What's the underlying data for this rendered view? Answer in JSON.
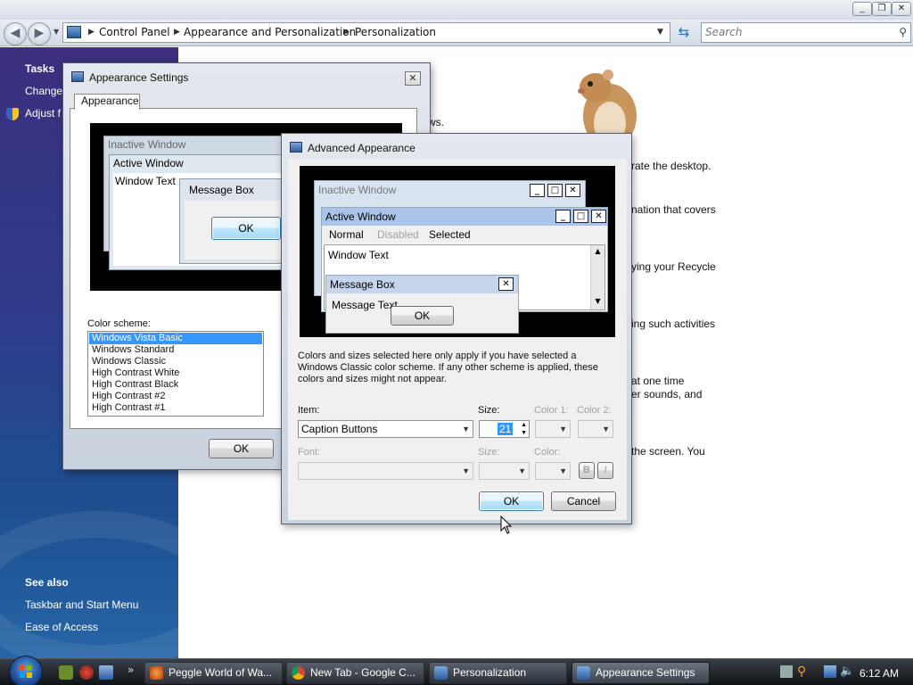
{
  "explorer": {
    "address_segments": [
      "Control Panel",
      "Appearance and Personalization",
      "Personalization"
    ],
    "search_placeholder": "Search"
  },
  "taskpane": {
    "tasks_heading": "Tasks",
    "task_items": [
      "Change",
      "Adjust f"
    ],
    "see_also_heading": "See also",
    "see_also_items": [
      "Taskbar and Start Menu",
      "Ease of Access"
    ]
  },
  "content": {
    "lines": [
      "ws.",
      "rate the desktop.",
      "nation that covers",
      "ying your Recycle",
      "ing such activities",
      "at one time",
      "er sounds, and",
      "the screen. You"
    ]
  },
  "appearance_dialog": {
    "title": "Appearance Settings",
    "tab_label": "Appearance",
    "preview": {
      "inactive_title": "Inactive Window",
      "active_title": "Active Window",
      "window_text": "Window Text",
      "message_box_title": "Message Box",
      "ok_label": "OK"
    },
    "color_scheme_label": "Color scheme:",
    "color_schemes": [
      "Windows Vista Basic",
      "Windows Standard",
      "Windows Classic",
      "High Contrast White",
      "High Contrast Black",
      "High Contrast #2",
      "High Contrast #1"
    ],
    "selected_scheme_index": 0,
    "ok_label": "OK"
  },
  "advanced_dialog": {
    "title": "Advanced Appearance",
    "preview": {
      "inactive_title": "Inactive Window",
      "active_title": "Active Window",
      "menu_normal": "Normal",
      "menu_disabled": "Disabled",
      "menu_selected": "Selected",
      "window_text": "Window Text",
      "message_box_title": "Message Box",
      "message_text": "Message Text",
      "ok_label": "OK"
    },
    "info_text": "Colors and sizes selected here only apply if you have selected a Windows Classic color scheme. If any other scheme is applied, these colors and sizes might not appear.",
    "item_label": "Item:",
    "item_value": "Caption Buttons",
    "size_label": "Size:",
    "size_value": "21",
    "color1_label": "Color 1:",
    "color2_label": "Color 2:",
    "font_label": "Font:",
    "font_size_label": "Size:",
    "font_color_label": "Color:",
    "bold_label": "B",
    "italic_label": "I",
    "ok_label": "OK",
    "cancel_label": "Cancel"
  },
  "taskbar": {
    "buttons": [
      "Peggle World of Wa...",
      "New Tab - Google C...",
      "Personalization",
      "Appearance Settings"
    ],
    "clock": "6:12 AM"
  },
  "colors": {
    "selection": "#3399ff",
    "active_caption": "#a9c4e8",
    "inactive_caption": "#d7e3f1"
  }
}
